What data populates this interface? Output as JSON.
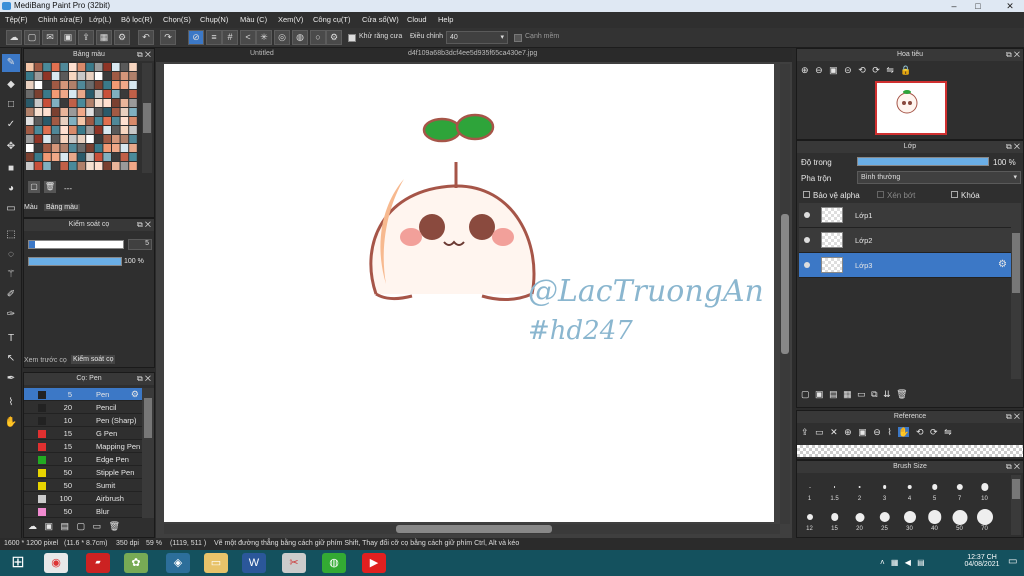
{
  "window": {
    "title": "MediBang Paint Pro (32bit)"
  },
  "menu": [
    "Tệp(F)",
    "Chỉnh sửa(E)",
    "Lớp(L)",
    "Bộ lọc(R)",
    "Chọn(S)",
    "Chụp(N)",
    "Màu (C)",
    "Xem(V)",
    "Công cụ(T)",
    "Cửa sổ(W)",
    "Cloud",
    "Help"
  ],
  "toolbar": {
    "antialias_label": "Khử răng cưa",
    "correction_label": "Điều chỉnh",
    "correction_value": "40",
    "smooth_label": "Cạnh mềm"
  },
  "palette_panel": {
    "title": "Bảng màu",
    "tab_color": "Màu",
    "tab_palette": "Bảng màu",
    "dash": "---"
  },
  "brush_control": {
    "title": "Kiểm soát cọ",
    "size_value": "5",
    "opacity_value": "100 %",
    "tab_preview": "Xem trước cọ",
    "tab_control": "Kiểm soát cọ"
  },
  "brush_panel": {
    "title": "Cọ: Pen",
    "brushes": [
      {
        "size": "5",
        "name": "Pen",
        "color": "#222222"
      },
      {
        "size": "20",
        "name": "Pencil",
        "color": "#222222"
      },
      {
        "size": "10",
        "name": "Pen (Sharp)",
        "color": "#222222"
      },
      {
        "size": "15",
        "name": "G Pen",
        "color": "#e03030"
      },
      {
        "size": "15",
        "name": "Mapping Pen",
        "color": "#e03030"
      },
      {
        "size": "10",
        "name": "Edge Pen",
        "color": "#22aa22"
      },
      {
        "size": "50",
        "name": "Stipple Pen",
        "color": "#e8d400"
      },
      {
        "size": "50",
        "name": "Sumit",
        "color": "#e8d400"
      },
      {
        "size": "100",
        "name": "Airbrush",
        "color": "#cccccc"
      },
      {
        "size": "50",
        "name": "Blur",
        "color": "#f08ad0"
      }
    ]
  },
  "canvas": {
    "tab1": "Untitled",
    "tab2": "d4f109a68b3dcf4ee5d935f65ca430e7.jpg",
    "watermark1": "@LacTruongAn",
    "watermark2": "#hd247"
  },
  "navigator": {
    "title": "Hoa tiêu"
  },
  "layers": {
    "title": "Lớp",
    "opacity_label": "Độ trong",
    "opacity_value": "100 %",
    "blend_label": "Pha trộn",
    "blend_value": "Bình thường",
    "alpha_label": "Bảo vệ alpha",
    "clip_label": "Xén bớt",
    "lock_label": "Khóa",
    "items": [
      "Lớp1",
      "Lớp2",
      "Lớp3"
    ]
  },
  "reference": {
    "title": "Reference"
  },
  "brush_size": {
    "title": "Brush Size",
    "row1": [
      "1",
      "1.5",
      "2",
      "3",
      "4",
      "5",
      "7",
      "10"
    ],
    "row2": [
      "12",
      "15",
      "20",
      "25",
      "30",
      "40",
      "50",
      "70"
    ]
  },
  "status": {
    "dims": "1600 * 1200 pixel",
    "cm": "(11.6 * 8.7cm)",
    "dpi": "350 dpi",
    "zoom": "59 %",
    "coords": "(1119, 511 )",
    "hint": "Vẽ một đường thẳng bằng cách giữ phím Shift, Thay đổi cỡ cọ bằng cách giữ phím Ctrl, Alt và kéo"
  },
  "taskbar": {
    "time": "12:37 CH",
    "date": "04/08/2021"
  },
  "colors": {
    "accent": "#3c78c6",
    "panel": "#2f2f2f",
    "taskbar": "#14515e"
  }
}
